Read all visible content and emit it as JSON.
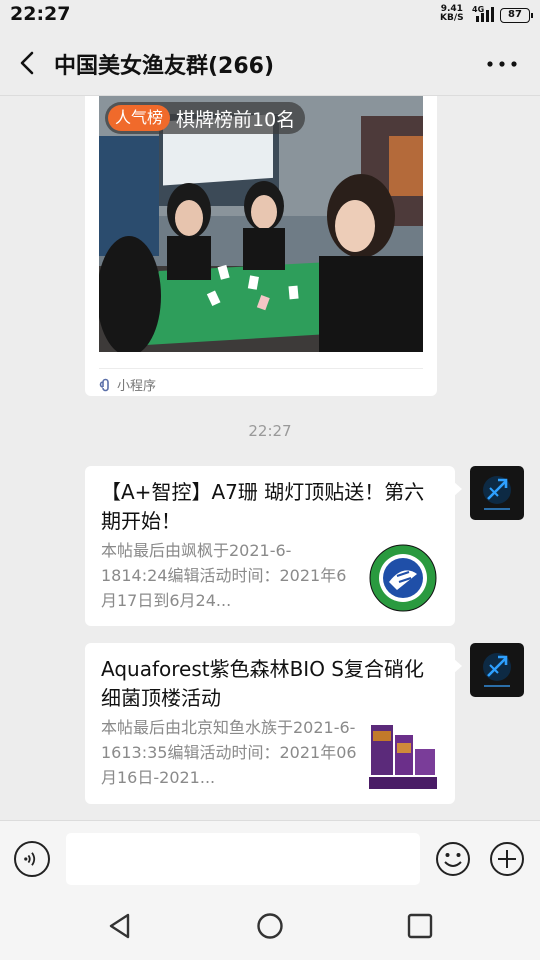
{
  "status_bar": {
    "time": "22:27",
    "net_speed": "9.41",
    "net_unit": "KB/S",
    "network": "4G",
    "battery": "87"
  },
  "header": {
    "title": "中国美女渔友群(266)",
    "back_icon": "chevron-left-icon",
    "more_icon": "more-dots-icon"
  },
  "mini_program_card": {
    "badge_tag": "人气榜",
    "badge_text": "棋牌榜前10名",
    "source_label": "小程序",
    "image_icon": "photo"
  },
  "timestamp": "22:27",
  "messages": [
    {
      "title": "【A+智控】A7珊 瑚灯顶贴送！第六期开始！",
      "description": "本帖最后由飒枫于2021-6-1814:24编辑活动时间：2021年6月17日到6月24...",
      "thumb": "green-club-logo"
    },
    {
      "title": "Aquaforest紫色森林BIO S复合硝化细菌顶楼活动",
      "description": "本帖最后由北京知鱼水族于2021-6-1613:35编辑活动时间：2021年06月16日-2021...",
      "thumb": "product-boxes"
    }
  ],
  "input_bar": {
    "placeholder": "",
    "voice_icon": "voice-icon",
    "emoji_icon": "emoji-icon",
    "plus_icon": "plus-icon"
  },
  "nav_bar": {
    "back_icon": "triangle-back-icon",
    "home_icon": "circle-home-icon",
    "recents_icon": "square-recents-icon"
  },
  "colors": {
    "background": "#ededed",
    "badge_orange": "#f06a2b",
    "avatar_bg": "#141414",
    "avatar_accent": "#1f8fd8"
  }
}
